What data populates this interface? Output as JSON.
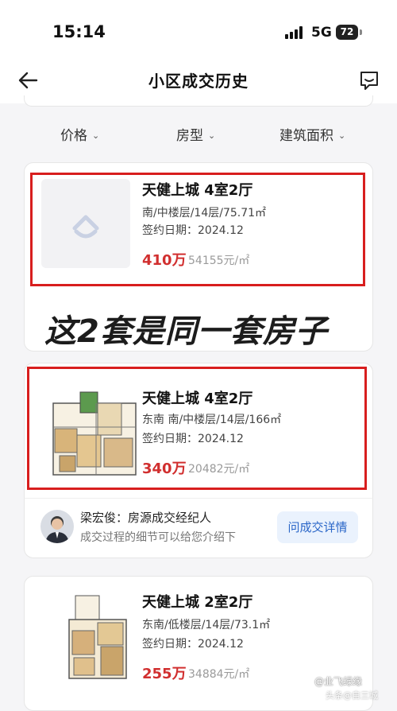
{
  "status": {
    "time": "15:14",
    "network": "5G",
    "battery": "72"
  },
  "nav": {
    "title": "小区成交历史"
  },
  "filters": [
    {
      "label": "价格"
    },
    {
      "label": "房型"
    },
    {
      "label": "建筑面积"
    }
  ],
  "listings": [
    {
      "title": "天健上城 4室2厅",
      "info": "南/中楼层/14层/75.71㎡",
      "date": "签约日期：2024.12",
      "price": "410万",
      "unit_price": "54155元/㎡"
    },
    {
      "title": "天健上城 4室2厅",
      "info": "东南 南/中楼层/14层/166㎡",
      "date": "签约日期：2024.12",
      "price": "340万",
      "unit_price": "20482元/㎡"
    },
    {
      "title": "天健上城 2室2厅",
      "info": "东南/低楼层/14层/73.1㎡",
      "date": "签约日期：2024.12",
      "price": "255万",
      "unit_price": "34884元/㎡"
    }
  ],
  "annotation": {
    "text": "这2套是同一套房子",
    "color": "#d81e1e"
  },
  "agent": {
    "name": "梁宏俊：房源成交经纪人",
    "desc": "成交过程的细节可以给您介绍下",
    "button": "问成交详情"
  },
  "watermark": {
    "line1": "@业飞绿缘",
    "line2": "头条@自三城"
  }
}
